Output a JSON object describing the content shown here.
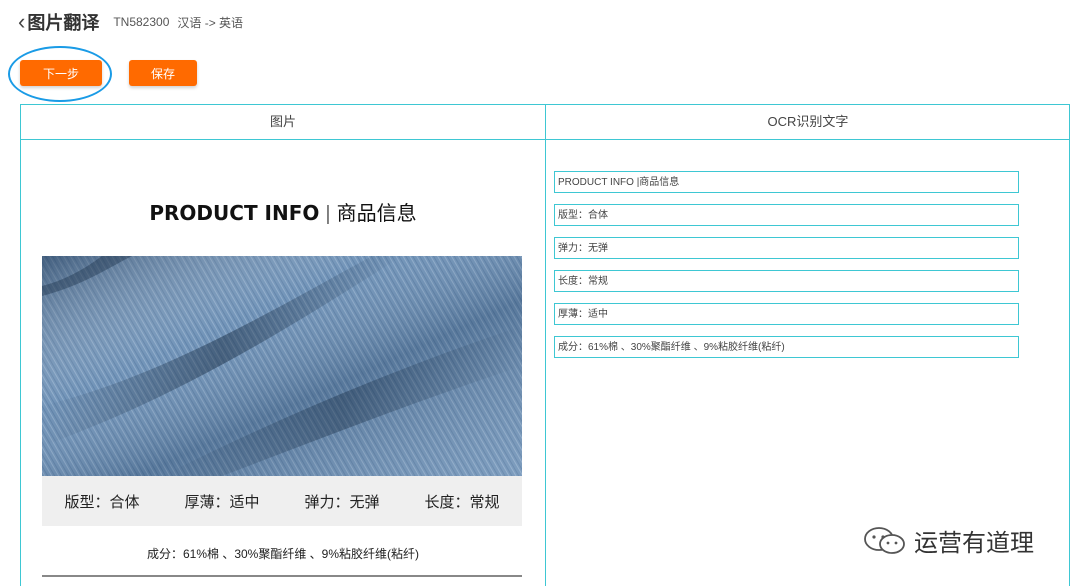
{
  "header": {
    "back_icon": "chevron-left-icon",
    "title": "图片翻译",
    "code": "TN582300",
    "lang": "汉语 -> 英语"
  },
  "toolbar": {
    "next_label": "下一步",
    "save_label": "保存",
    "button_color": "#ff6a00"
  },
  "table": {
    "col_image": "图片",
    "col_ocr": "OCR识别文字",
    "border_color": "#3ec7d3"
  },
  "image_panel": {
    "title_en": "PRODUCT INFO",
    "title_sep": "|",
    "title_cn": "商品信息",
    "attributes": [
      "版型：合体",
      "厚薄：适中",
      "弹力：无弹",
      "长度：常规"
    ],
    "composition": "成分：61%棉 、30%聚酯纤维 、9%粘胶纤维(粘纤)"
  },
  "ocr_results": [
    "PRODUCT INFO |商品信息",
    "版型：合体",
    "弹力：无弹",
    "长度：常规",
    "厚薄：适中",
    "成分：61%棉 、30%聚酯纤维 、9%粘胶纤维(粘纤)"
  ],
  "watermark": {
    "icon": "wechat-icon",
    "text": "运营有道理"
  }
}
